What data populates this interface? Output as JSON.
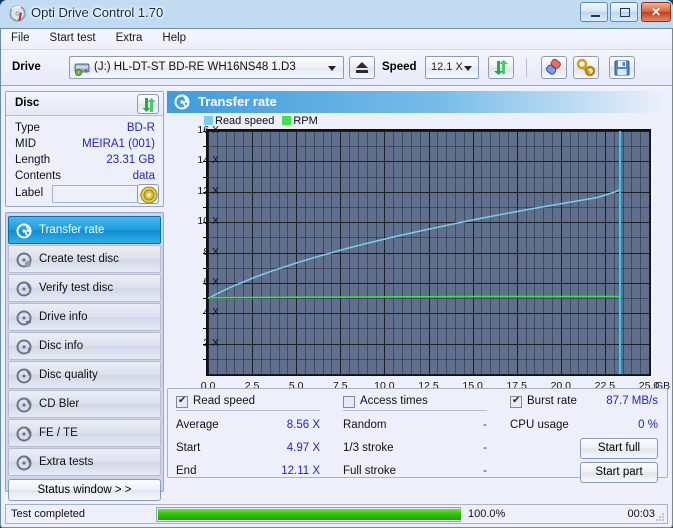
{
  "window": {
    "title": "Opti Drive Control 1.70",
    "icon": "disc-icon",
    "minimize_label": "Minimize",
    "maximize_label": "Maximize",
    "close_label": "✕"
  },
  "menu": [
    {
      "label": "File"
    },
    {
      "label": "Start test"
    },
    {
      "label": "Extra"
    },
    {
      "label": "Help"
    }
  ],
  "toolbar": {
    "drive_label": "Drive",
    "drive_value": "(J:)   HL-DT-ST BD-RE  WH16NS48 1.D3",
    "eject_label": "eject-button",
    "speed_label": "Speed",
    "speed_value": "12.1 X",
    "refresh_label": "refresh-button",
    "erase_label": "erase-button",
    "tools_label": "tools-button",
    "save_label": "save-button"
  },
  "disc": {
    "header": "Disc",
    "refresh_label": "refresh-disc-button",
    "rows": [
      {
        "key": "Type",
        "value": "BD-R"
      },
      {
        "key": "MID",
        "value": "MEIRA1 (001)"
      },
      {
        "key": "Length",
        "value": "23.31 GB"
      },
      {
        "key": "Contents",
        "value": "data"
      }
    ],
    "label_key": "Label",
    "label_value": "",
    "label_placeholder": ""
  },
  "nav": {
    "items": [
      {
        "label": "Transfer rate",
        "icon": "disc-transfer-icon",
        "active": true
      },
      {
        "label": "Create test disc",
        "icon": "disc-create-icon",
        "active": false
      },
      {
        "label": "Verify test disc",
        "icon": "disc-verify-icon",
        "active": false
      },
      {
        "label": "Drive info",
        "icon": "disc-drive-icon",
        "active": false
      },
      {
        "label": "Disc info",
        "icon": "disc-info-icon",
        "active": false
      },
      {
        "label": "Disc quality",
        "icon": "disc-quality-icon",
        "active": false
      },
      {
        "label": "CD Bler",
        "icon": "disc-bler-icon",
        "active": false
      },
      {
        "label": "FE / TE",
        "icon": "disc-fete-icon",
        "active": false
      },
      {
        "label": "Extra tests",
        "icon": "disc-extra-icon",
        "active": false
      }
    ],
    "status_window_label": "Status window > >"
  },
  "content": {
    "title": "Transfer rate",
    "icon": "disc-transfer-icon"
  },
  "chart_data": {
    "type": "line",
    "title": "Transfer rate",
    "xlabel": "GB",
    "ylabel": "X",
    "xlim": [
      0.0,
      25.0
    ],
    "ylim": [
      0,
      16
    ],
    "grid": true,
    "legend_position": "top-left",
    "xticks": [
      "0.0",
      "2.5",
      "5.0",
      "7.5",
      "10.0",
      "12.5",
      "15.0",
      "17.5",
      "20.0",
      "22.5",
      "25.0"
    ],
    "xtick_values": [
      0.0,
      2.5,
      5.0,
      7.5,
      10.0,
      12.5,
      15.0,
      17.5,
      20.0,
      22.5,
      25.0
    ],
    "yticks": [
      "2 X",
      "4 X",
      "6 X",
      "8 X",
      "10 X",
      "12 X",
      "14 X",
      "16 X"
    ],
    "ytick_values": [
      2,
      4,
      6,
      8,
      10,
      12,
      14,
      16
    ],
    "x_unit": "GB",
    "cursor_x": 23.31,
    "series": [
      {
        "name": "Read speed",
        "color": "#79cdef",
        "x": [
          0.0,
          0.5,
          1.0,
          1.5,
          2.0,
          2.5,
          3.0,
          3.5,
          4.0,
          4.5,
          5.0,
          6.0,
          7.0,
          8.0,
          9.0,
          10.0,
          11.0,
          12.0,
          13.0,
          14.0,
          15.0,
          16.0,
          17.0,
          18.0,
          19.0,
          20.0,
          21.0,
          22.0,
          23.0,
          23.31
        ],
        "values": [
          4.97,
          5.28,
          5.56,
          5.82,
          6.06,
          6.3,
          6.52,
          6.73,
          6.93,
          7.12,
          7.31,
          7.66,
          7.99,
          8.3,
          8.6,
          8.88,
          9.15,
          9.41,
          9.66,
          9.9,
          10.14,
          10.37,
          10.59,
          10.8,
          11.01,
          11.21,
          11.41,
          11.6,
          11.96,
          12.11
        ]
      },
      {
        "name": "RPM",
        "color": "#3ce34a",
        "x": [
          0.0,
          4.6,
          14.8,
          23.31
        ],
        "values": [
          5.02,
          5.05,
          5.1,
          5.1
        ]
      }
    ]
  },
  "stats": {
    "read_speed": {
      "checkbox_label": "Read speed",
      "checked": true,
      "rows": [
        {
          "key": "Average",
          "value": "8.56 X"
        },
        {
          "key": "Start",
          "value": "4.97 X"
        },
        {
          "key": "End",
          "value": "12.11 X"
        }
      ]
    },
    "access_times": {
      "checkbox_label": "Access times",
      "checked": false,
      "rows": [
        {
          "key": "Random",
          "value": "-"
        },
        {
          "key": "1/3 stroke",
          "value": "-"
        },
        {
          "key": "Full stroke",
          "value": "-"
        }
      ]
    },
    "burst": {
      "checkbox_label": "Burst rate",
      "checked": true,
      "burst_value": "87.7 MB/s",
      "cpu_key": "CPU usage",
      "cpu_value": "0 %",
      "start_full_label": "Start full",
      "start_part_label": "Start part"
    }
  },
  "statusbar": {
    "text": "Test completed",
    "percent_label": "100.0%",
    "percent_value": 100.0,
    "elapsed": "00:03"
  },
  "colors": {
    "accent": "#1f9ddd",
    "read_speed": "#79cdef",
    "rpm": "#3ce34a",
    "value_text": "#2222c8",
    "progress": "#2cc000",
    "plot_bg": "#5f6f8c"
  }
}
